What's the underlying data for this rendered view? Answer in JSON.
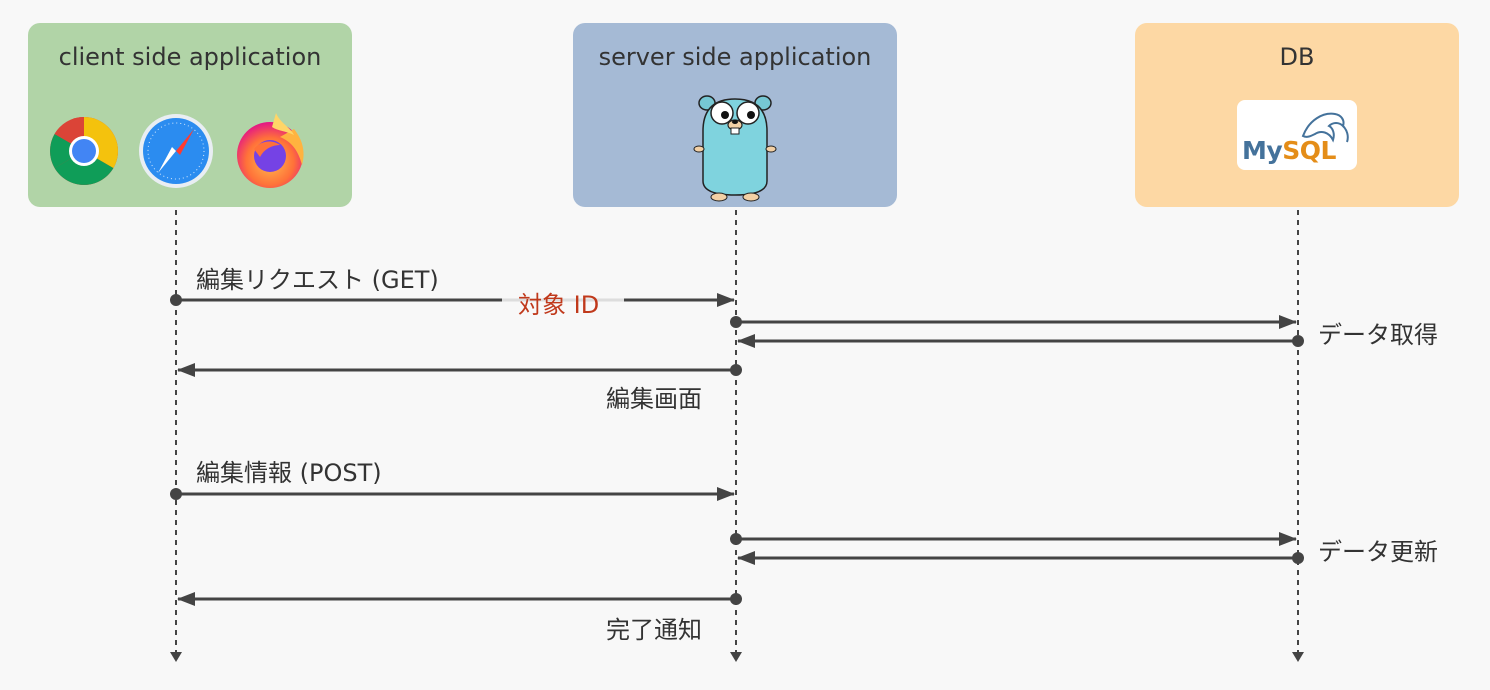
{
  "actors": {
    "client": {
      "title": "client side application",
      "icons": [
        "chrome-icon",
        "safari-icon",
        "firefox-icon"
      ]
    },
    "server": {
      "title": "server side application",
      "icons": [
        "go-gopher-icon"
      ]
    },
    "db": {
      "title": "DB",
      "icons": [
        "mysql-logo"
      ],
      "logo_text_my": "My",
      "logo_text_sql": "SQL"
    }
  },
  "messages": {
    "edit_request": "編集リクエスト (GET)",
    "target_id": "対象 ID",
    "data_fetch": "データ取得",
    "edit_screen": "編集画面",
    "edit_info": "編集情報 (POST)",
    "data_update": "データ更新",
    "complete_notice": "完了通知"
  },
  "colors": {
    "client_box": "#b1d4a7",
    "server_box": "#a5bad5",
    "db_box": "#fdd8a4",
    "arrow": "#444444",
    "highlight_text": "#c0391b",
    "background": "#f8f8f8"
  }
}
